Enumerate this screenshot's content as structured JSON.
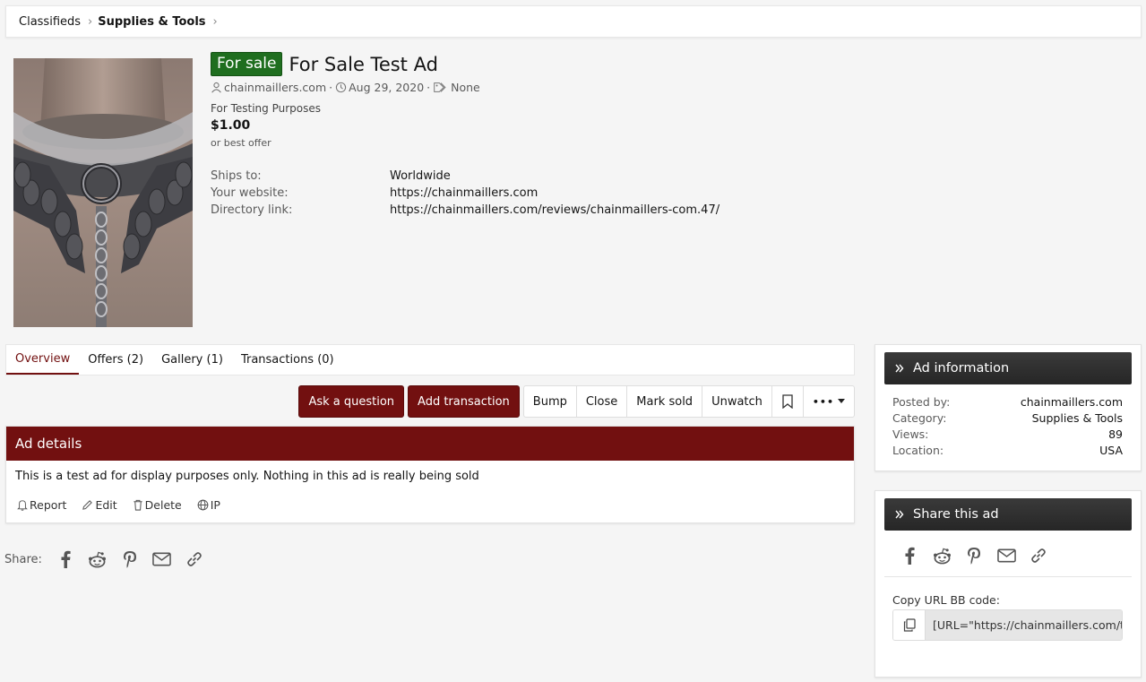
{
  "breadcrumb": {
    "items": [
      "Classifieds",
      "Supplies & Tools"
    ],
    "sep": "›"
  },
  "ad": {
    "prefix": "For sale",
    "title": "For Sale Test Ad",
    "author": "chainmaillers.com",
    "date": "Aug 29, 2020",
    "tags": "None",
    "subtitle": "For Testing Purposes",
    "price": "$1.00",
    "price_note": "or best offer",
    "fields": [
      {
        "label": "Ships to:",
        "value": "Worldwide"
      },
      {
        "label": "Your website:",
        "value": "https://chainmaillers.com"
      },
      {
        "label": "Directory link:",
        "value": "https://chainmaillers.com/reviews/chainmaillers-com.47/"
      }
    ]
  },
  "tabs": [
    "Overview",
    "Offers (2)",
    "Gallery (1)",
    "Transactions (0)"
  ],
  "buttons": {
    "ask": "Ask a question",
    "add_transaction": "Add transaction",
    "bump": "Bump",
    "close": "Close",
    "mark_sold": "Mark sold",
    "unwatch": "Unwatch",
    "more": "•••"
  },
  "details": {
    "heading": "Ad details",
    "body": "This is a test ad for display purposes only. Nothing in this ad is really being sold",
    "actions": {
      "report": "Report",
      "edit": "Edit",
      "delete": "Delete",
      "ip": "IP"
    }
  },
  "share": {
    "label": "Share:"
  },
  "sidebar": {
    "info_title": "Ad information",
    "info": [
      {
        "k": "Posted by:",
        "v": "chainmaillers.com"
      },
      {
        "k": "Category:",
        "v": "Supplies & Tools"
      },
      {
        "k": "Views:",
        "v": "89"
      },
      {
        "k": "Location:",
        "v": "USA"
      }
    ],
    "share_title": "Share this ad",
    "copy_label": "Copy URL BB code:",
    "copy_value": "[URL=\"https://chainmaillers.com/tes"
  },
  "colors": {
    "accent": "#721010",
    "prefix_green": "#1f6e1f",
    "sidebar_head": "#2e2e2e"
  },
  "icons": [
    "user-icon",
    "clock-icon",
    "tag-icon",
    "bookmark-icon",
    "bell-icon",
    "pencil-icon",
    "trash-icon",
    "globe-icon",
    "facebook-icon",
    "reddit-icon",
    "pinterest-icon",
    "email-icon",
    "link-icon",
    "chevrons-right-icon",
    "copy-icon"
  ]
}
